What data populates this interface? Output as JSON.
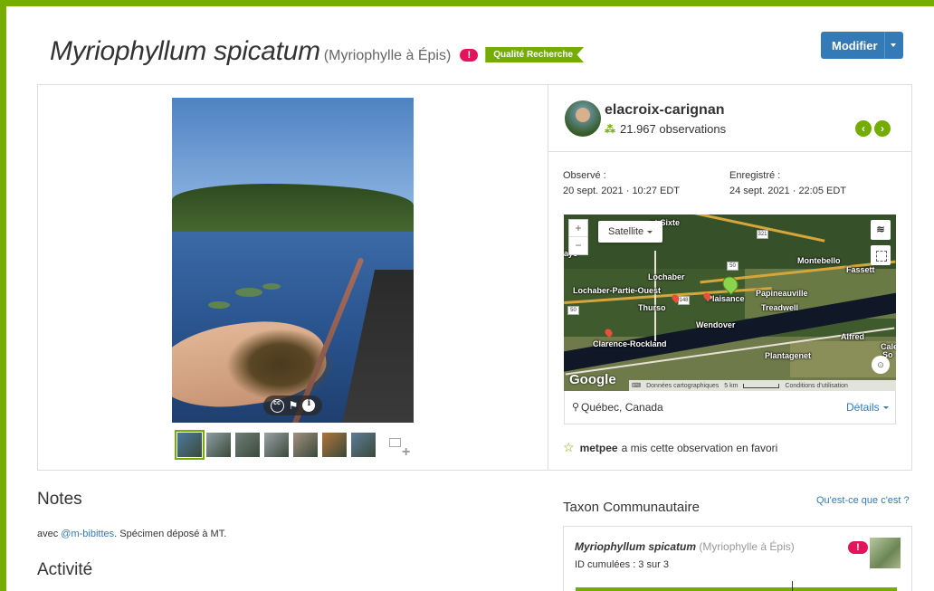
{
  "header": {
    "scientific_name": "Myriophyllum spicatum",
    "common_name": "(Myriophylle à Épis)",
    "alert_badge": "!",
    "quality_grade": "Qualité Recherche",
    "modify_button": "Modifier"
  },
  "photo": {
    "controls": [
      "cc-icon",
      "flag-icon",
      "info-icon"
    ],
    "thumbnail_count": 7,
    "active_thumbnail": 0,
    "thumbnail_colors": [
      "#4c7a9e",
      "#8e9ea3",
      "#6f7f7a",
      "#9aa1a5",
      "#a28f80",
      "#b0743a",
      "#5d7c99"
    ]
  },
  "user": {
    "username": "elacroix-carignan",
    "observations": "21.967 observations"
  },
  "meta": {
    "observed_label": "Observé :",
    "observed_value": "20 sept. 2021 · 10:27 EDT",
    "recorded_label": "Enregistré :",
    "recorded_value": "24 sept. 2021 · 22:05 EDT"
  },
  "map": {
    "type_selector": "Satellite",
    "zoom_in": "+",
    "zoom_out": "−",
    "labels": {
      "sainte_sixte": "nt-Sixte",
      "mayo": "ayo",
      "montebello": "Montebello",
      "fassett": "Fassett",
      "lochaber": "Lochaber",
      "lochaber_po": "Lochaber-Partie-Ouest",
      "plaisance": "Plaisance",
      "papineauville": "Papineauville",
      "thurso": "Thurso",
      "treadwell": "Treadwell",
      "wendover": "Wendover",
      "clarence": "Clarence-Rockland",
      "alfred": "Alfred",
      "plantagenet": "Plantagenet",
      "cale": "Cale",
      "so": "So"
    },
    "shields": [
      "321",
      "50",
      "148",
      "50"
    ],
    "google": "Google",
    "attribution": "Données cartographiques",
    "scale": "5 km",
    "terms": "Conditions d'utilisation"
  },
  "location": {
    "place": "Québec, Canada",
    "details_link": "Détails"
  },
  "favorite": {
    "user": "metpee",
    "text": "a mis cette observation en favori"
  },
  "notes": {
    "heading": "Notes",
    "prefix": "avec ",
    "mention": "@m-bibittes",
    "suffix": ". Spécimen déposé à MT."
  },
  "activity": {
    "heading": "Activité"
  },
  "community_taxon": {
    "heading": "Taxon Communautaire",
    "whats_this": "Qu'est-ce que c'est ?",
    "scientific_name": "Myriophyllum spicatum",
    "common_name": "(Myriophylle à Épis)",
    "cumulative_ids": "ID cumulées : 3 sur 3",
    "alert_badge": "!"
  },
  "colors": {
    "brand_green": "#74ac00",
    "link_blue": "#337ab7",
    "alert_pink": "#e4145c"
  }
}
